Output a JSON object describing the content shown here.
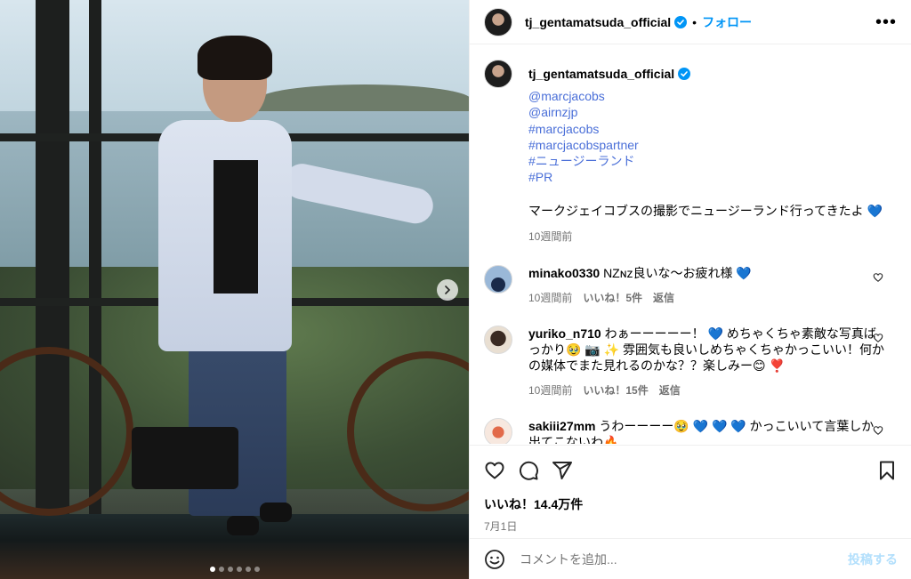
{
  "post": {
    "username": "tj_gentamatsuda_official",
    "follow_label": "フォロー",
    "bullet": "•",
    "more_label": "•••",
    "carousel": {
      "total_slides": 6,
      "active_index": 0
    }
  },
  "caption": {
    "username": "tj_gentamatsuda_official",
    "tags": [
      "@marcjacobs",
      "@airnzjp",
      "#marcjacobs",
      "#marcjacobspartner",
      "#ニュージーランド",
      "#PR"
    ],
    "text": "マークジェイコブスの撮影でニュージーランド行ってきたよ 💙",
    "time": "10週間前"
  },
  "comments": [
    {
      "username": "minako0330",
      "text": "NZɴᴢ良いな〜お疲れ様 💙",
      "time": "10週間前",
      "likes": "いいね！5件",
      "reply": "返信"
    },
    {
      "username": "yuriko_n710",
      "text": "わぁーーーーー！ 💙 めちゃくちゃ素敵な写真ばっかり🥹 📷 ✨ 雰囲気も良いしめちゃくちゃかっこいい！何かの媒体でまた見れるのかな？？楽しみー😊 ❣️",
      "time": "10週間前",
      "likes": "いいね！15件",
      "reply": "返信"
    },
    {
      "username": "sakiii27mm",
      "text": "うわーーーー🥹 💙 💙 💙 かっこいいて言葉しか出てこないわ🔥",
      "time": "",
      "likes": "",
      "reply": ""
    }
  ],
  "footer": {
    "likes": "いいね！14.4万件",
    "date": "7月1日",
    "comment_placeholder": "コメントを追加...",
    "post_label": "投稿する"
  },
  "colors": {
    "link": "#4a6fd8",
    "follow": "#0095f6",
    "verified": "#0095f6",
    "muted": "#737373"
  }
}
